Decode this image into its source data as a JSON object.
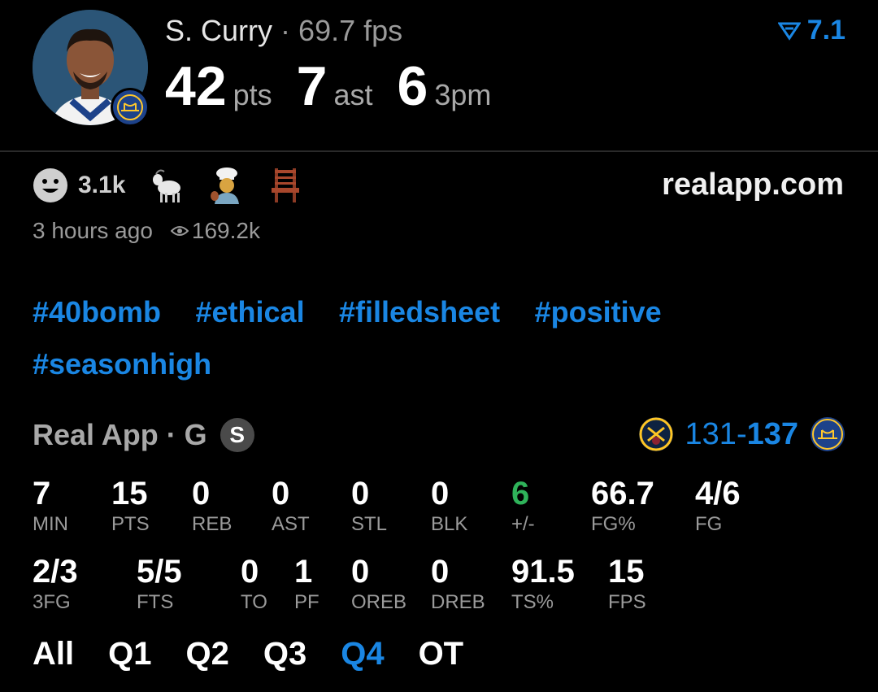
{
  "header": {
    "player_name": "S. Curry",
    "separator": "·",
    "fps_label": "69.7 fps",
    "score_value": "7.1",
    "stats": [
      {
        "value": "42",
        "unit": "pts"
      },
      {
        "value": "7",
        "unit": "ast"
      },
      {
        "value": "6",
        "unit": "3pm"
      }
    ]
  },
  "reactions": {
    "count": "3.1k",
    "emojis": [
      "goat-emoji",
      "cook-emoji",
      "chair-emoji"
    ],
    "site": "realapp.com",
    "time_ago": "3 hours ago",
    "views": "169.2k"
  },
  "tags": [
    "#40bomb",
    "#ethical",
    "#filledsheet",
    "#positive",
    "#seasonhigh"
  ],
  "game": {
    "label": "Real App · G",
    "badge": "S",
    "away_score": "131",
    "dash": "-",
    "home_score": "137"
  },
  "stats_row1": [
    {
      "value": "7",
      "label": "MIN"
    },
    {
      "value": "15",
      "label": "PTS"
    },
    {
      "value": "0",
      "label": "REB"
    },
    {
      "value": "0",
      "label": "AST"
    },
    {
      "value": "0",
      "label": "STL"
    },
    {
      "value": "0",
      "label": "BLK"
    },
    {
      "value": "6",
      "label": "+/-"
    },
    {
      "value": "66.7",
      "label": "FG%"
    },
    {
      "value": "4/6",
      "label": "FG"
    }
  ],
  "stats_row2": [
    {
      "value": "2/3",
      "label": "3FG"
    },
    {
      "value": "5/5",
      "label": "FTS"
    },
    {
      "value": "0",
      "label": "TO"
    },
    {
      "value": "1",
      "label": "PF"
    },
    {
      "value": "0",
      "label": "OREB"
    },
    {
      "value": "0",
      "label": "DREB"
    },
    {
      "value": "91.5",
      "label": "TS%"
    },
    {
      "value": "15",
      "label": "FPS"
    }
  ],
  "quarters": {
    "tabs": [
      "All",
      "Q1",
      "Q2",
      "Q3",
      "Q4",
      "OT"
    ],
    "active": "Q4"
  },
  "colors": {
    "accent": "#1a86e3",
    "positive": "#2fb35a",
    "muted": "#9a9a9a"
  }
}
